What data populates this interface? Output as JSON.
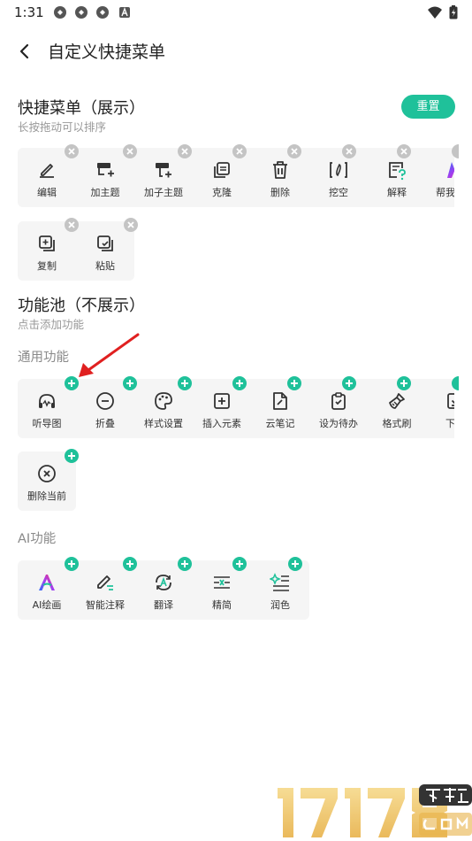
{
  "status_bar": {
    "time": "1:31"
  },
  "header": {
    "title": "自定义快捷菜单"
  },
  "shortcut_menu": {
    "title": "快捷菜单（展示）",
    "subtitle": "长按拖动可以排序",
    "reset_label": "重置",
    "items_row1": [
      {
        "label": "编辑",
        "icon": "edit-icon"
      },
      {
        "label": "加主题",
        "icon": "add-topic-icon"
      },
      {
        "label": "加子主题",
        "icon": "add-subtopic-icon"
      },
      {
        "label": "克隆",
        "icon": "clone-icon"
      },
      {
        "label": "删除",
        "icon": "trash-icon"
      },
      {
        "label": "挖空",
        "icon": "blank-icon"
      },
      {
        "label": "解释",
        "icon": "explain-icon"
      },
      {
        "label": "帮我思考",
        "icon": "ai-think-icon"
      }
    ],
    "items_row2": [
      {
        "label": "复制",
        "icon": "copy-icon"
      },
      {
        "label": "粘贴",
        "icon": "paste-icon"
      }
    ]
  },
  "function_pool": {
    "title": "功能池（不展示）",
    "subtitle": "点击添加功能",
    "general": {
      "title": "通用功能",
      "items_row1": [
        {
          "label": "听导图",
          "icon": "listen-icon"
        },
        {
          "label": "折叠",
          "icon": "collapse-icon"
        },
        {
          "label": "样式设置",
          "icon": "palette-icon"
        },
        {
          "label": "插入元素",
          "icon": "insert-icon"
        },
        {
          "label": "云笔记",
          "icon": "cloud-note-icon"
        },
        {
          "label": "设为待办",
          "icon": "todo-icon"
        },
        {
          "label": "格式刷",
          "icon": "format-brush-icon"
        },
        {
          "label": "下钻",
          "icon": "drill-down-icon"
        }
      ],
      "items_row2": [
        {
          "label": "删除当前",
          "icon": "delete-current-icon"
        }
      ]
    },
    "ai": {
      "title": "AI功能",
      "items": [
        {
          "label": "AI绘画",
          "icon": "ai-paint-icon"
        },
        {
          "label": "智能注释",
          "icon": "smart-annotate-icon"
        },
        {
          "label": "翻译",
          "icon": "translate-icon"
        },
        {
          "label": "精简",
          "icon": "simplify-icon"
        },
        {
          "label": "润色",
          "icon": "polish-icon"
        }
      ]
    }
  },
  "colors": {
    "accent": "#1fc19a",
    "remove_badge": "#c4c4c4",
    "tile_bg": "#f5f5f5",
    "arrow": "#e02020"
  }
}
